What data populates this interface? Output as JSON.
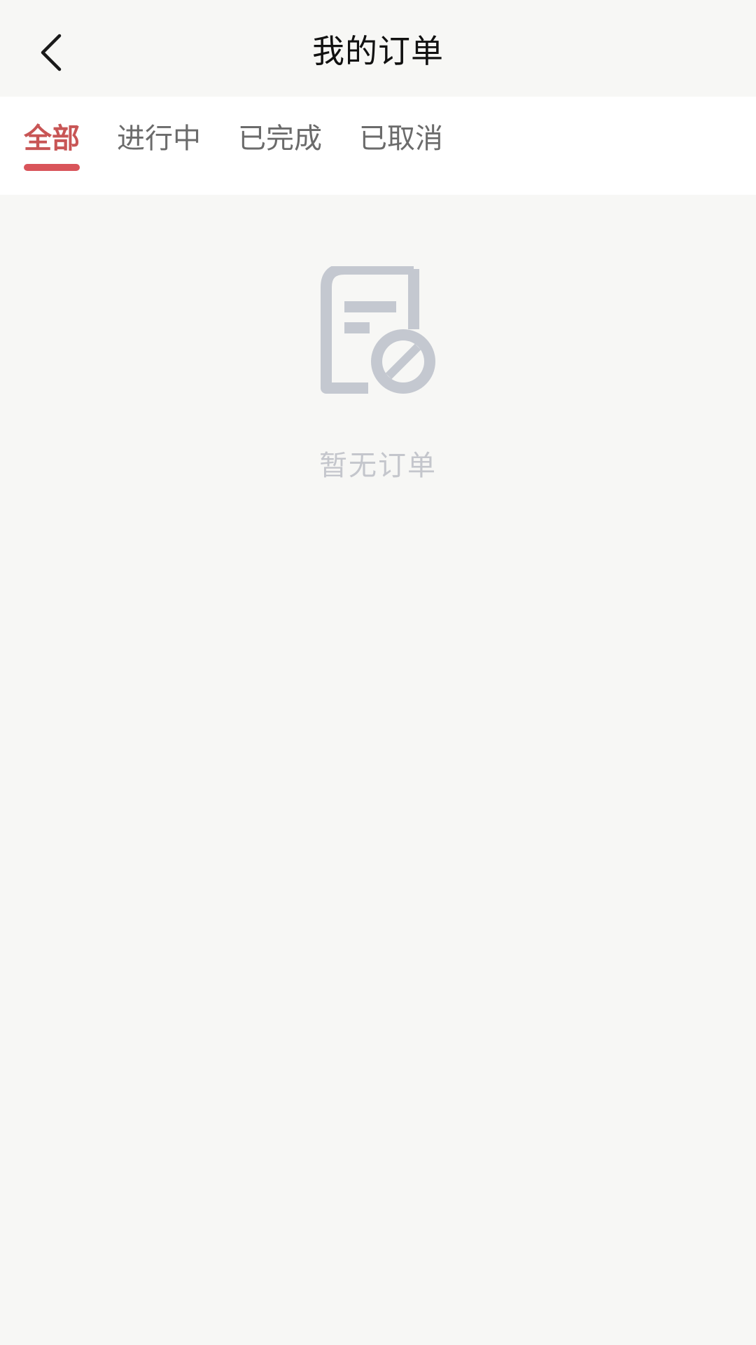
{
  "header": {
    "title": "我的订单",
    "back_icon": "chevron-left-icon"
  },
  "tabs": [
    {
      "label": "全部",
      "active": true
    },
    {
      "label": "进行中",
      "active": false
    },
    {
      "label": "已完成",
      "active": false
    },
    {
      "label": "已取消",
      "active": false
    }
  ],
  "empty_state": {
    "icon": "no-order-document-icon",
    "message": "暂无订单"
  },
  "colors": {
    "accent": "#d9545a",
    "active_tab_text": "#c85555",
    "inactive_tab_text": "#6b6b6b",
    "empty_icon": "#c4c8d0",
    "empty_text": "#c4c6cc",
    "page_background": "#f7f7f5"
  }
}
